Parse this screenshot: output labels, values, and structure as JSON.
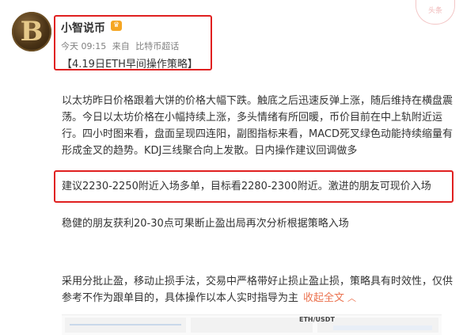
{
  "post": {
    "author": {
      "name": "小智说币",
      "avatar_letter": "B",
      "badge_icon": "vip-crown-icon"
    },
    "meta": {
      "time": "今天 09:15",
      "source_prefix": "来自",
      "source": "比特币超话"
    },
    "title": "【4.19日ETH早间操作策略】",
    "stamp_text": "头条",
    "paragraphs": {
      "analysis": "以太坊昨日价格跟着大饼的价格大幅下跌。触底之后迅速反弹上涨，随后维持在横盘震荡。今日以太坊价格在小幅持续上涨，多头情绪有所回暖，币价目前在中上轨附近运行。四小时图来看，盘面呈现四连阳，副图指标来看，MACD死叉绿色动能持续缩量有形成金叉的趋势。KDJ三线聚合向上发散。日内操作建议回调做多",
      "suggestion": "建议2230-2250附近入场多单，目标看2280-2300附近。激进的朋友可现价入场",
      "stop_rule": "稳健的朋友获利20-30点可果断止盈出局再次分析根据策略入场",
      "disclaimer": "采用分批止盈，移动止损手法，交易中严格带好止损止盈止损，策略具有时效性，仅供参考不作为跟单目的，具体操作以本人实时指导为主"
    },
    "collapse_label": "收起全文",
    "collapse_icon": "chevron-up-icon",
    "thumbnail_label": "ETH/USDT"
  },
  "colors": {
    "highlight_border": "#e02020",
    "link": "#eb7350",
    "meta_text": "#808080"
  }
}
